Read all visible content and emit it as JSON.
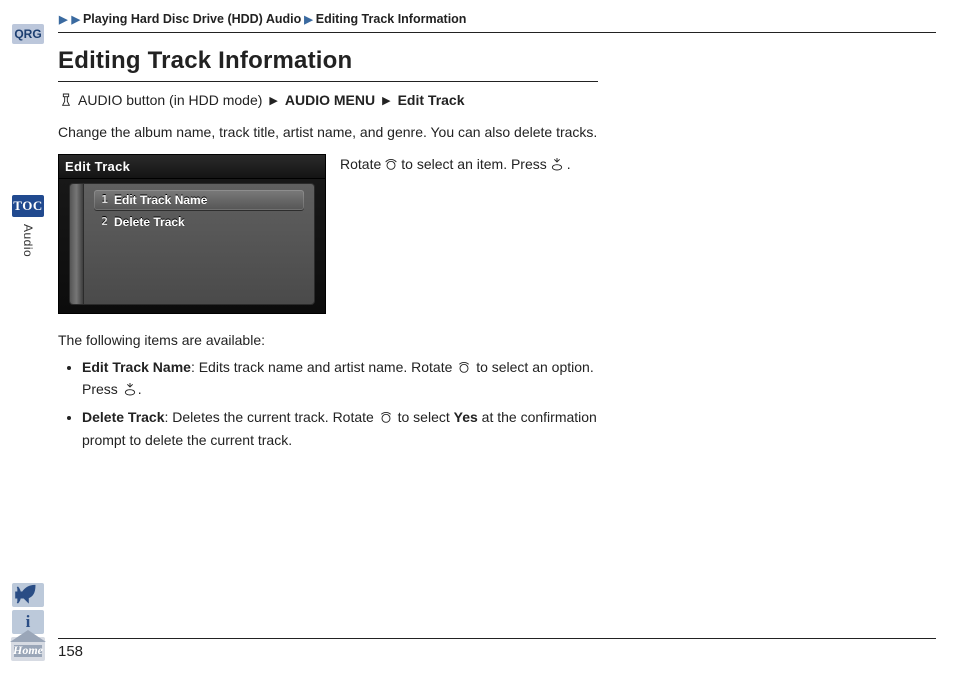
{
  "breadcrumb": {
    "section": "Playing Hard Disc Drive (HDD) Audio",
    "page": "Editing Track Information"
  },
  "title": "Editing Track Information",
  "nav": {
    "pre": "AUDIO button (in HDD mode)",
    "m1": "AUDIO MENU",
    "m2": "Edit Track"
  },
  "intro": "Change the album name, track title, artist name, and genre. You can also delete tracks.",
  "screen": {
    "header": "Edit Track",
    "items": [
      {
        "n": "1",
        "label": "Edit Track Name"
      },
      {
        "n": "2",
        "label": "Delete Track"
      }
    ]
  },
  "side_caption": {
    "a": "Rotate",
    "b": "to select an item. Press",
    "c": "."
  },
  "available_label": "The following items are available:",
  "bullets": {
    "edit": {
      "name": "Edit Track Name",
      "text_a": ": Edits track name and artist name. Rotate",
      "text_b": "to select an option. Press",
      "text_c": "."
    },
    "del": {
      "name": "Delete Track",
      "text_a": ": Deletes the current track. Rotate",
      "text_b": "to select",
      "yes": "Yes",
      "text_c": "at the confirmation prompt to delete the current track."
    }
  },
  "rail": {
    "qrg": "QRG",
    "toc": "TOC",
    "audio": "Audio",
    "home": "Home"
  },
  "page_number": "158"
}
